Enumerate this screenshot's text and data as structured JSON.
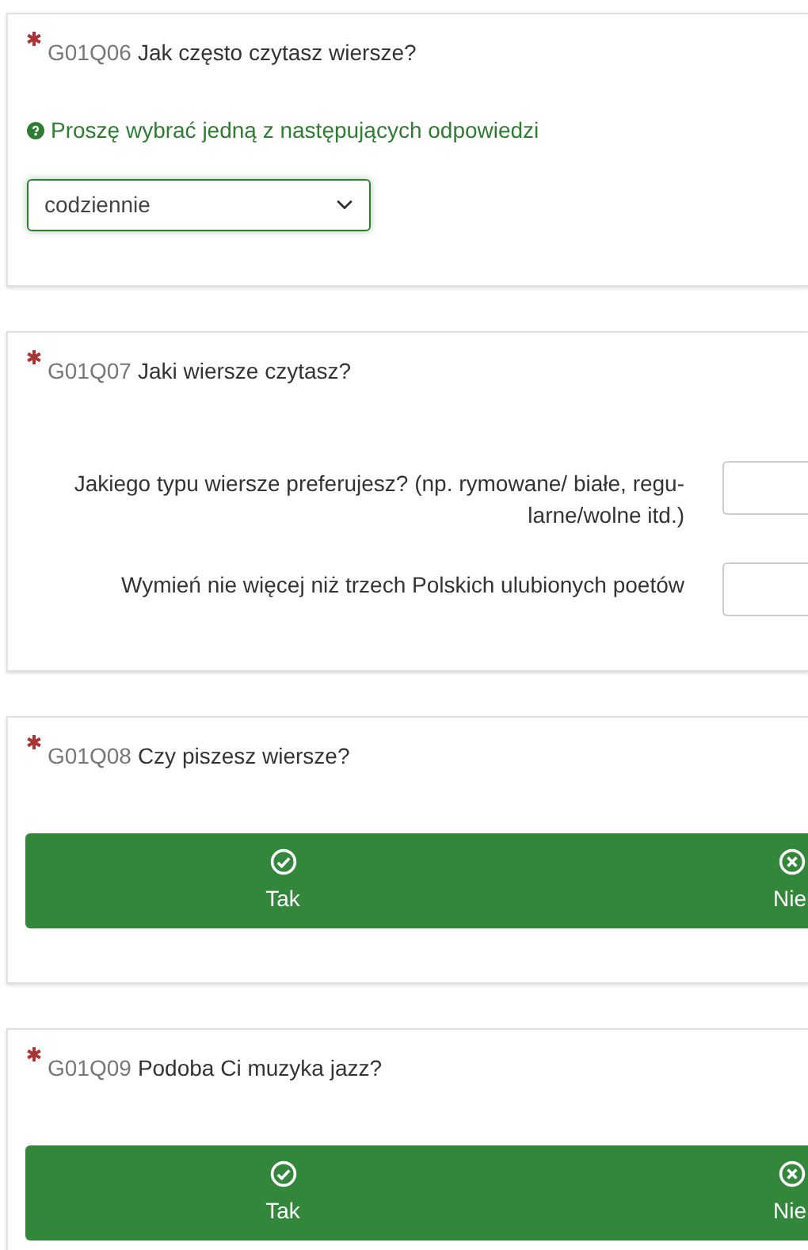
{
  "questions": [
    {
      "kind": "dropdown",
      "code": "G01Q06",
      "text": "Jak często czytasz wiersze?",
      "required": true,
      "help": "Proszę wybrać jedną z następujących odpowiedzi",
      "value": "codziennie"
    },
    {
      "kind": "multi_text",
      "code": "G01Q07",
      "text": "Jaki wiersze czytasz?",
      "required": true,
      "subquestions": [
        {
          "label": "Jakiego typu wiersze preferujesz? (np. rymowane/ białe, regu-larne/wolne itd.)"
        },
        {
          "label": "Wymień nie więcej niż trzech Polskich ulubionych poetów"
        }
      ]
    },
    {
      "kind": "yes_no",
      "code": "G01Q08",
      "text": "Czy piszesz wiersze?",
      "required": true,
      "options": [
        {
          "kind": "yes",
          "label": "Tak"
        },
        {
          "kind": "no",
          "label": "Nie"
        }
      ]
    },
    {
      "kind": "yes_no",
      "code": "G01Q09",
      "text": "Podoba Ci muzyka jazz?",
      "required": true,
      "options": [
        {
          "kind": "yes",
          "label": "Tak"
        },
        {
          "kind": "no",
          "label": "Nie"
        }
      ]
    }
  ]
}
